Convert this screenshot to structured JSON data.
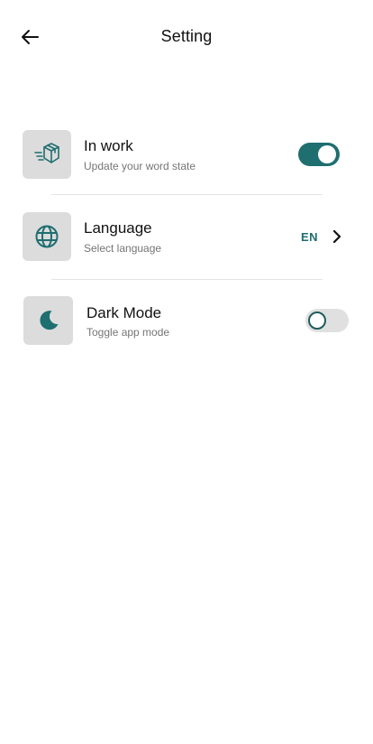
{
  "header": {
    "title": "Setting",
    "back_icon": "arrow-left-icon"
  },
  "settings": {
    "in_work": {
      "title": "In work",
      "subtitle": "Update your word state",
      "icon": "box-delivery-icon",
      "toggle_on": true
    },
    "language": {
      "title": "Language",
      "subtitle": "Select language",
      "icon": "globe-icon",
      "value": "EN",
      "chevron_icon": "chevron-right-icon"
    },
    "dark_mode": {
      "title": "Dark Mode",
      "subtitle": "Toggle app mode",
      "icon": "moon-icon",
      "toggle_on": false
    }
  },
  "colors": {
    "accent": "#1f6e70",
    "icon_bg": "#dcdcdc",
    "subtitle": "#757575",
    "divider": "#e4e4e4"
  }
}
